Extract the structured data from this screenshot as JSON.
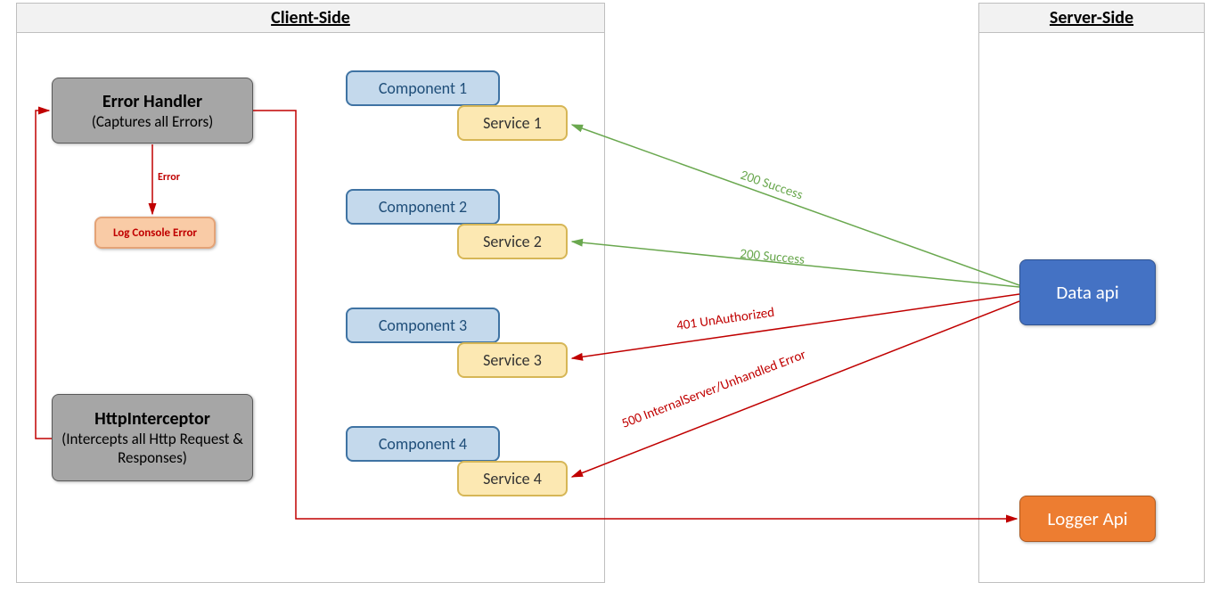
{
  "containers": {
    "client": {
      "title": "Client-Side"
    },
    "server": {
      "title": "Server-Side"
    }
  },
  "nodes": {
    "errorHandler": {
      "title": "Error Handler",
      "sub": "(Captures all Errors)"
    },
    "httpInterceptor": {
      "title": "HttpInterceptor",
      "sub": "(Intercepts all Http Request & Responses)"
    },
    "logConsole": {
      "label": "Log Console Error"
    },
    "comp1": {
      "label": "Component 1"
    },
    "comp2": {
      "label": "Component 2"
    },
    "comp3": {
      "label": "Component 3"
    },
    "comp4": {
      "label": "Component 4"
    },
    "svc1": {
      "label": "Service 1"
    },
    "svc2": {
      "label": "Service 2"
    },
    "svc3": {
      "label": "Service 3"
    },
    "svc4": {
      "label": "Service 4"
    },
    "dataApi": {
      "label": "Data api"
    },
    "loggerApi": {
      "label": "Logger Api"
    }
  },
  "labels": {
    "errorArrow": "Error",
    "s1": "200 Success",
    "s2": "200 Success",
    "s3": "401 UnAuthorized",
    "s4": "500 InternalServer/Unhandled Error"
  },
  "colors": {
    "green": "#6aa84f",
    "red": "#c00000"
  }
}
